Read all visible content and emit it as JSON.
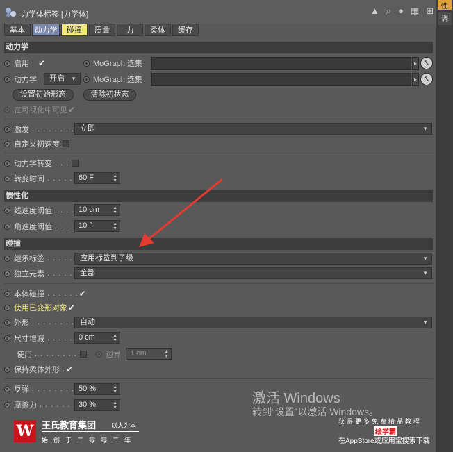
{
  "window": {
    "title": "力学体标签 [力学体]"
  },
  "tabs": [
    {
      "label": "基本"
    },
    {
      "label": "动力学"
    },
    {
      "label": "碰撞"
    },
    {
      "label": "质量"
    },
    {
      "label": "力"
    },
    {
      "label": "柔体"
    },
    {
      "label": "缓存"
    }
  ],
  "dynamics": {
    "header": "动力学",
    "enable_label": "启用",
    "mograph_label_1": "MoGraph 选集",
    "dynamic_label": "动力学",
    "dynamic_value": "开启",
    "mograph_label_2": "MoGraph 选集",
    "set_initial_button": "设置初始形态",
    "clear_initial_button": "清除初状态",
    "visible_label": "在可视化中可见",
    "trigger_label": "激发",
    "trigger_value": "立即",
    "custom_velocity_label": "自定义初速度",
    "transition_label": "动力学转变",
    "transition_time_label": "转变时间",
    "transition_time_value": "60 F"
  },
  "inertia": {
    "header": "惯性化",
    "linear_label": "线速度阈值",
    "linear_value": "10 cm",
    "angular_label": "角速度阈值",
    "angular_value": "10 °"
  },
  "collision": {
    "header": "碰撞",
    "inherit_label": "继承标签",
    "inherit_value": "应用标签到子级",
    "individual_label": "独立元素",
    "individual_value": "全部",
    "self_collision_label": "本体碰撞",
    "deformed_label": "使用已变形对象",
    "shape_label": "外形",
    "shape_value": "自动",
    "size_increment_label": "尺寸增减",
    "size_increment_value": "0 cm",
    "use_label": "使用",
    "margin_label": "边界",
    "margin_value": "1 cm",
    "keep_soft_label": "保持柔体外形",
    "bounce_label": "反弹",
    "bounce_value": "50 %",
    "friction_label": "摩擦力",
    "friction_value": "30 %"
  },
  "right_tabs": [
    "性",
    "调"
  ],
  "overlay": {
    "activate_title": "激活 Windows",
    "activate_sub": "转到“设置”以激活 Windows。",
    "logo_glyph": "W",
    "logo_name": "王氏教育集团",
    "logo_slogan": "以人为本",
    "logo_sub": "始创于二零零二年",
    "ad_top": "获得更多免费精品教程",
    "ad_mid": "绘学霸",
    "ad_bot": "在AppStore或应用宝搜索下载"
  },
  "colors": {
    "active_tab": "#7b88ad",
    "highlight_tab": "#f1ea7a",
    "right_tab_active": "#e0a33a",
    "arrow": "#e53a2f"
  }
}
